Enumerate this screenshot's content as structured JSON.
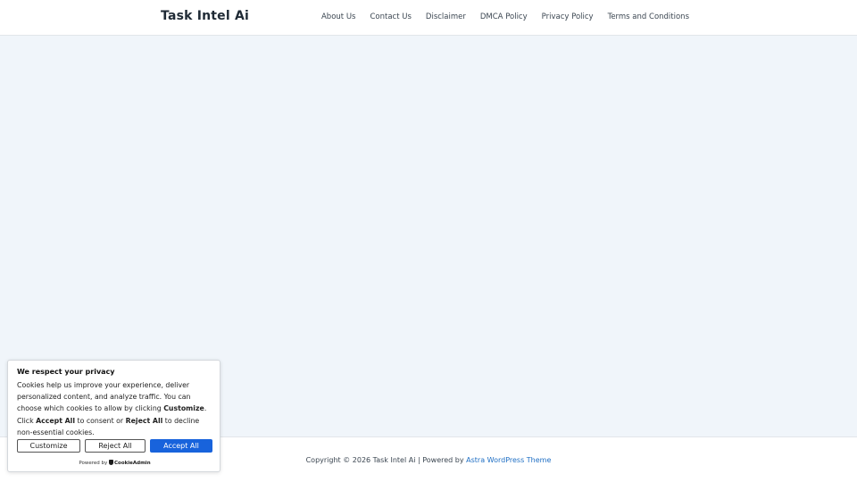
{
  "header": {
    "site_title": "Task Intel Ai",
    "nav": [
      {
        "label": "About Us"
      },
      {
        "label": "Contact Us"
      },
      {
        "label": "Disclaimer"
      },
      {
        "label": "DMCA Policy"
      },
      {
        "label": "Privacy Policy"
      },
      {
        "label": "Terms and Conditions"
      }
    ]
  },
  "footer": {
    "copyright": "Copyright © 2026 Task Intel Ai | Powered by ",
    "theme_link": "Astra WordPress Theme"
  },
  "cookie_banner": {
    "title": "We respect your privacy",
    "body_parts": [
      "Cookies help us improve your experience, deliver personalized content, and analyze traffic. You can choose which cookies to allow by clicking ",
      "Customize",
      ". Click ",
      "Accept All",
      " to consent or ",
      "Reject All",
      " to decline non-essential cookies."
    ],
    "buttons": {
      "customize": "Customize",
      "reject": "Reject All",
      "accept": "Accept All"
    },
    "powered_by": "Powered by",
    "brand": "CookieAdmin"
  },
  "colors": {
    "page_background": "#f0f5fa",
    "accent": "#1863dc",
    "link": "#1f6fc4"
  }
}
